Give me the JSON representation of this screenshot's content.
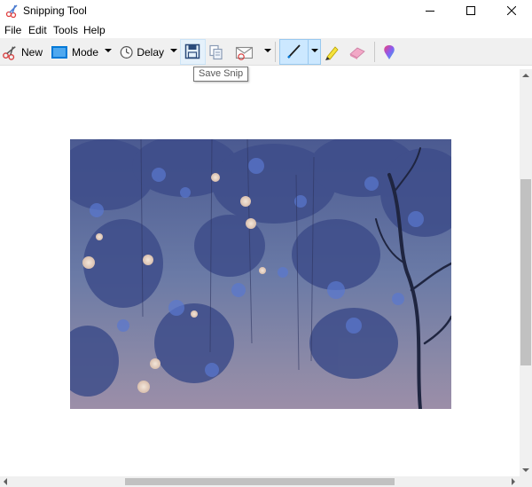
{
  "window": {
    "title": "Snipping Tool",
    "controls": {
      "minimize": "minimize",
      "maximize": "maximize",
      "close": "close"
    }
  },
  "menu": [
    "File",
    "Edit",
    "Tools",
    "Help"
  ],
  "toolbar": {
    "new_label": "New",
    "mode_label": "Mode",
    "delay_label": "Delay",
    "icons": {
      "new": "scissors-icon",
      "mode": "rectangle-snip-icon",
      "delay": "clock-icon",
      "save": "floppy-disk-icon",
      "copy": "copy-icon",
      "send": "envelope-icon",
      "pen": "pen-icon",
      "highlighter": "highlighter-icon",
      "eraser": "eraser-icon",
      "paint3d": "paint-3d-icon"
    },
    "pen_active": true
  },
  "tooltip": {
    "text": "Save Snip"
  },
  "colors": {
    "toolbar_bg": "#f0f0f0",
    "pressed_bg": "#cce8ff",
    "hover_bg": "#e5f1fb",
    "accent_blue": "#0078d7"
  },
  "snip": {
    "content": "captured-painting-image"
  }
}
